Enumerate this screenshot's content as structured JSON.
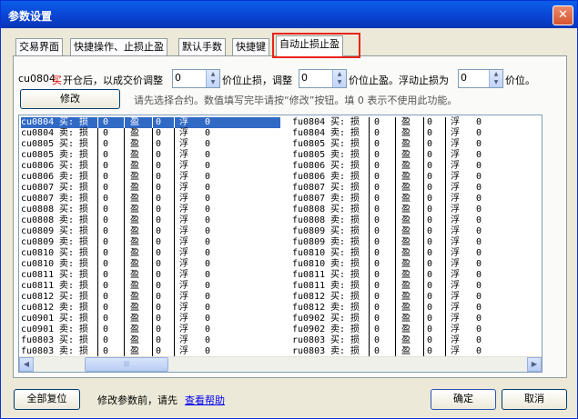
{
  "window": {
    "title": "参数设置",
    "close_label": "✕"
  },
  "tabs": [
    "交易界面",
    "快捷操作、止损止盈",
    "默认手数",
    "快捷键",
    "自动止损止盈"
  ],
  "settings": {
    "contract_code": "cu0804",
    "direction_word": "买",
    "text_after_direction": "开仓后，以成交价调整",
    "stop_loss_value": "0",
    "label_stop_loss": "价位止损，调整",
    "take_profit_value": "0",
    "label_take_profit": "价位止盈。浮动止损为",
    "trailing_value": "0",
    "label_trailing": "价位。"
  },
  "modify_button": "修改",
  "hint": "请先选择合约。数值填写完毕请按“修改”按钮。填 0 表示不使用此功能。",
  "rows_left": [
    {
      "code": "cu0804",
      "side": "买:",
      "loss": "损",
      "lv": "0",
      "prof": "盈",
      "pv": "0",
      "float": "浮",
      "fv": "0"
    },
    {
      "code": "cu0804",
      "side": "卖:",
      "loss": "损",
      "lv": "0",
      "prof": "盈",
      "pv": "0",
      "float": "浮",
      "fv": "0"
    },
    {
      "code": "cu0805",
      "side": "买:",
      "loss": "损",
      "lv": "0",
      "prof": "盈",
      "pv": "0",
      "float": "浮",
      "fv": "0"
    },
    {
      "code": "cu0805",
      "side": "卖:",
      "loss": "损",
      "lv": "0",
      "prof": "盈",
      "pv": "0",
      "float": "浮",
      "fv": "0"
    },
    {
      "code": "cu0806",
      "side": "买:",
      "loss": "损",
      "lv": "0",
      "prof": "盈",
      "pv": "0",
      "float": "浮",
      "fv": "0"
    },
    {
      "code": "cu0806",
      "side": "卖:",
      "loss": "损",
      "lv": "0",
      "prof": "盈",
      "pv": "0",
      "float": "浮",
      "fv": "0"
    },
    {
      "code": "cu0807",
      "side": "买:",
      "loss": "损",
      "lv": "0",
      "prof": "盈",
      "pv": "0",
      "float": "浮",
      "fv": "0"
    },
    {
      "code": "cu0807",
      "side": "卖:",
      "loss": "损",
      "lv": "0",
      "prof": "盈",
      "pv": "0",
      "float": "浮",
      "fv": "0"
    },
    {
      "code": "cu0808",
      "side": "买:",
      "loss": "损",
      "lv": "0",
      "prof": "盈",
      "pv": "0",
      "float": "浮",
      "fv": "0"
    },
    {
      "code": "cu0808",
      "side": "卖:",
      "loss": "损",
      "lv": "0",
      "prof": "盈",
      "pv": "0",
      "float": "浮",
      "fv": "0"
    },
    {
      "code": "cu0809",
      "side": "买:",
      "loss": "损",
      "lv": "0",
      "prof": "盈",
      "pv": "0",
      "float": "浮",
      "fv": "0"
    },
    {
      "code": "cu0809",
      "side": "卖:",
      "loss": "损",
      "lv": "0",
      "prof": "盈",
      "pv": "0",
      "float": "浮",
      "fv": "0"
    },
    {
      "code": "cu0810",
      "side": "买:",
      "loss": "损",
      "lv": "0",
      "prof": "盈",
      "pv": "0",
      "float": "浮",
      "fv": "0"
    },
    {
      "code": "cu0810",
      "side": "卖:",
      "loss": "损",
      "lv": "0",
      "prof": "盈",
      "pv": "0",
      "float": "浮",
      "fv": "0"
    },
    {
      "code": "cu0811",
      "side": "买:",
      "loss": "损",
      "lv": "0",
      "prof": "盈",
      "pv": "0",
      "float": "浮",
      "fv": "0"
    },
    {
      "code": "cu0811",
      "side": "卖:",
      "loss": "损",
      "lv": "0",
      "prof": "盈",
      "pv": "0",
      "float": "浮",
      "fv": "0"
    },
    {
      "code": "cu0812",
      "side": "买:",
      "loss": "损",
      "lv": "0",
      "prof": "盈",
      "pv": "0",
      "float": "浮",
      "fv": "0"
    },
    {
      "code": "cu0812",
      "side": "卖:",
      "loss": "损",
      "lv": "0",
      "prof": "盈",
      "pv": "0",
      "float": "浮",
      "fv": "0"
    },
    {
      "code": "cu0901",
      "side": "买:",
      "loss": "损",
      "lv": "0",
      "prof": "盈",
      "pv": "0",
      "float": "浮",
      "fv": "0"
    },
    {
      "code": "cu0901",
      "side": "卖:",
      "loss": "损",
      "lv": "0",
      "prof": "盈",
      "pv": "0",
      "float": "浮",
      "fv": "0"
    },
    {
      "code": "fu0803",
      "side": "买:",
      "loss": "损",
      "lv": "0",
      "prof": "盈",
      "pv": "0",
      "float": "浮",
      "fv": "0"
    },
    {
      "code": "fu0803",
      "side": "卖:",
      "loss": "损",
      "lv": "0",
      "prof": "盈",
      "pv": "0",
      "float": "浮",
      "fv": "0"
    }
  ],
  "rows_right": [
    {
      "code": "fu0804",
      "side": "买:",
      "loss": "损",
      "lv": "0",
      "prof": "盈",
      "pv": "0",
      "float": "浮",
      "fv": "0"
    },
    {
      "code": "fu0804",
      "side": "卖:",
      "loss": "损",
      "lv": "0",
      "prof": "盈",
      "pv": "0",
      "float": "浮",
      "fv": "0"
    },
    {
      "code": "fu0805",
      "side": "买:",
      "loss": "损",
      "lv": "0",
      "prof": "盈",
      "pv": "0",
      "float": "浮",
      "fv": "0"
    },
    {
      "code": "fu0805",
      "side": "卖:",
      "loss": "损",
      "lv": "0",
      "prof": "盈",
      "pv": "0",
      "float": "浮",
      "fv": "0"
    },
    {
      "code": "fu0806",
      "side": "买:",
      "loss": "损",
      "lv": "0",
      "prof": "盈",
      "pv": "0",
      "float": "浮",
      "fv": "0"
    },
    {
      "code": "fu0806",
      "side": "卖:",
      "loss": "损",
      "lv": "0",
      "prof": "盈",
      "pv": "0",
      "float": "浮",
      "fv": "0"
    },
    {
      "code": "fu0807",
      "side": "买:",
      "loss": "损",
      "lv": "0",
      "prof": "盈",
      "pv": "0",
      "float": "浮",
      "fv": "0"
    },
    {
      "code": "fu0807",
      "side": "卖:",
      "loss": "损",
      "lv": "0",
      "prof": "盈",
      "pv": "0",
      "float": "浮",
      "fv": "0"
    },
    {
      "code": "fu0808",
      "side": "买:",
      "loss": "损",
      "lv": "0",
      "prof": "盈",
      "pv": "0",
      "float": "浮",
      "fv": "0"
    },
    {
      "code": "fu0808",
      "side": "卖:",
      "loss": "损",
      "lv": "0",
      "prof": "盈",
      "pv": "0",
      "float": "浮",
      "fv": "0"
    },
    {
      "code": "fu0809",
      "side": "买:",
      "loss": "损",
      "lv": "0",
      "prof": "盈",
      "pv": "0",
      "float": "浮",
      "fv": "0"
    },
    {
      "code": "fu0809",
      "side": "卖:",
      "loss": "损",
      "lv": "0",
      "prof": "盈",
      "pv": "0",
      "float": "浮",
      "fv": "0"
    },
    {
      "code": "fu0810",
      "side": "买:",
      "loss": "损",
      "lv": "0",
      "prof": "盈",
      "pv": "0",
      "float": "浮",
      "fv": "0"
    },
    {
      "code": "fu0810",
      "side": "卖:",
      "loss": "损",
      "lv": "0",
      "prof": "盈",
      "pv": "0",
      "float": "浮",
      "fv": "0"
    },
    {
      "code": "fu0811",
      "side": "买:",
      "loss": "损",
      "lv": "0",
      "prof": "盈",
      "pv": "0",
      "float": "浮",
      "fv": "0"
    },
    {
      "code": "fu0811",
      "side": "卖:",
      "loss": "损",
      "lv": "0",
      "prof": "盈",
      "pv": "0",
      "float": "浮",
      "fv": "0"
    },
    {
      "code": "fu0812",
      "side": "买:",
      "loss": "损",
      "lv": "0",
      "prof": "盈",
      "pv": "0",
      "float": "浮",
      "fv": "0"
    },
    {
      "code": "fu0812",
      "side": "卖:",
      "loss": "损",
      "lv": "0",
      "prof": "盈",
      "pv": "0",
      "float": "浮",
      "fv": "0"
    },
    {
      "code": "fu0902",
      "side": "买:",
      "loss": "损",
      "lv": "0",
      "prof": "盈",
      "pv": "0",
      "float": "浮",
      "fv": "0"
    },
    {
      "code": "fu0902",
      "side": "卖:",
      "loss": "损",
      "lv": "0",
      "prof": "盈",
      "pv": "0",
      "float": "浮",
      "fv": "0"
    },
    {
      "code": "ru0803",
      "side": "买:",
      "loss": "损",
      "lv": "0",
      "prof": "盈",
      "pv": "0",
      "float": "浮",
      "fv": "0"
    },
    {
      "code": "ru0803",
      "side": "卖:",
      "loss": "损",
      "lv": "0",
      "prof": "盈",
      "pv": "0",
      "float": "浮",
      "fv": "0"
    }
  ],
  "footer": {
    "reset_all": "全部复位",
    "help_prefix": "修改参数前，请先",
    "help_link": "查看帮助",
    "ok": "确定",
    "cancel": "取消"
  },
  "colors": {
    "selected_row": "#316ac5",
    "highlight_box": "#e8231b",
    "direction_word": "#e00000"
  }
}
